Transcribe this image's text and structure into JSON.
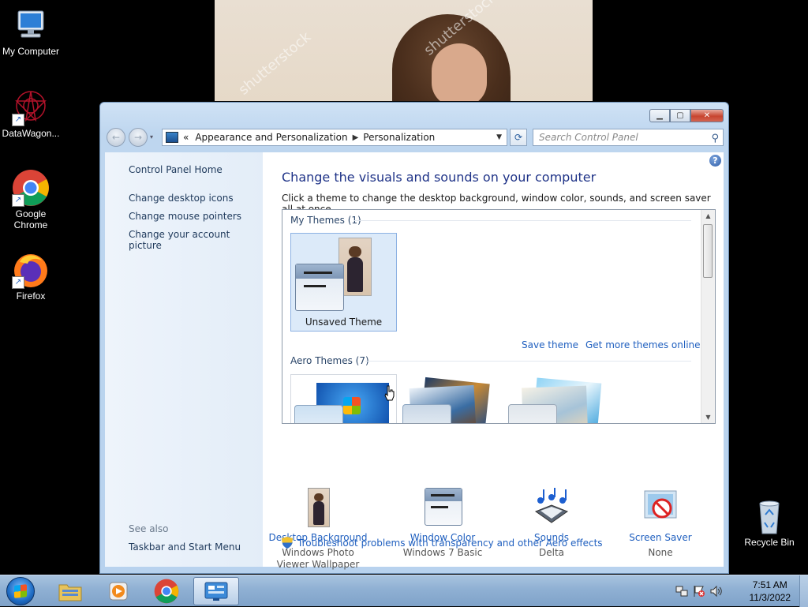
{
  "desktop": {
    "icons": [
      {
        "label": "My Computer"
      },
      {
        "label": "DataWagon..."
      },
      {
        "label": "Google Chrome"
      },
      {
        "label": "Firefox"
      },
      {
        "label": "Recycle Bin"
      }
    ]
  },
  "wallpaper": {
    "watermark": "shutterstock"
  },
  "window": {
    "address": {
      "prefix": "«",
      "crumbs": [
        "Appearance and Personalization",
        "Personalization"
      ]
    },
    "search_placeholder": "Search Control Panel",
    "left_pane": {
      "home_link": "Control Panel Home",
      "links": [
        "Change desktop icons",
        "Change mouse pointers",
        "Change your account picture"
      ],
      "see_also_label": "See also",
      "see_also_links": [
        "Taskbar and Start Menu"
      ]
    },
    "main": {
      "heading": "Change the visuals and sounds on your computer",
      "subtext": "Click a theme to change the desktop background, window color, sounds, and screen saver all at once.",
      "groups": {
        "my_themes": "My Themes (1)",
        "aero_themes": "Aero Themes (7)"
      },
      "unsaved_theme_label": "Unsaved Theme",
      "save_theme": "Save theme",
      "get_more_themes": "Get more themes online",
      "bottom_items": [
        {
          "label": "Desktop Background",
          "value": "Windows Photo Viewer Wallpaper",
          "icon": "photo-thumbnail-icon"
        },
        {
          "label": "Window Color",
          "value": "Windows 7 Basic",
          "icon": "window-color-icon"
        },
        {
          "label": "Sounds",
          "value": "Delta",
          "icon": "music-notes-icon"
        },
        {
          "label": "Screen Saver",
          "value": "None",
          "icon": "screen-saver-disabled-icon"
        }
      ],
      "troubleshoot_link": "Troubleshoot problems with transparency and other Aero effects"
    }
  },
  "taskbar": {
    "clock": {
      "time": "7:51 AM",
      "date": "11/3/2022"
    }
  },
  "colors": {
    "link": "#1f5fbf",
    "heading": "#1e3287",
    "taskbar": "#8fb0d3"
  }
}
